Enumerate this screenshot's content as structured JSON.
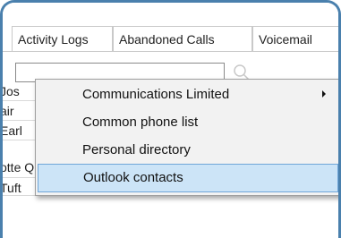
{
  "tabs": [
    "Activity Logs",
    "Abandoned Calls",
    "Voicemail"
  ],
  "search": {
    "value": "",
    "placeholder": ""
  },
  "list_rows": [
    "Jos",
    "air",
    "Earl",
    "otte Quartly",
    "Tuft"
  ],
  "context_menu": {
    "items": [
      {
        "label": "Communications Limited",
        "has_submenu": true
      },
      {
        "label": "Common phone list",
        "has_submenu": false
      },
      {
        "label": "Personal directory",
        "has_submenu": false
      },
      {
        "label": "Outlook contacts",
        "has_submenu": false,
        "highlighted": true
      }
    ]
  },
  "colors": {
    "frame": "#4a80ad",
    "highlight": "#cce4f7",
    "highlight_border": "#6fa6d8",
    "menu_bg": "#f2f2f2"
  }
}
